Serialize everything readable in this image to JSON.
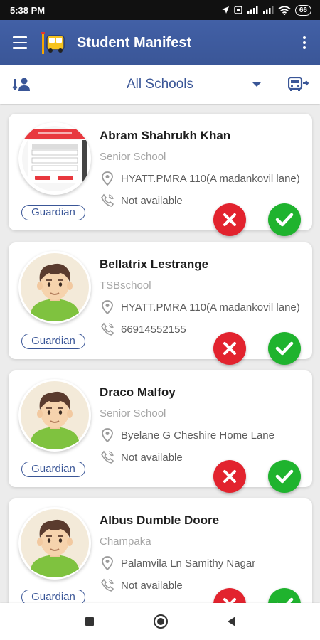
{
  "status_bar": {
    "time": "5:38 PM",
    "battery": "66"
  },
  "app_bar": {
    "title": "Student Manifest",
    "icons": [
      "menu-icon",
      "bus-logo-icon",
      "more-vert-icon"
    ]
  },
  "filter": {
    "selected_school": "All Schools",
    "left_icon": "person-sort-icon",
    "right_icon": "bus-arrow-icon"
  },
  "students": [
    {
      "name": "Abram Shahrukh Khan",
      "school": "Senior School",
      "address": "HYATT.PMRA 110(A madankovil lane)",
      "phone": "Not available",
      "role": "Guardian",
      "avatar": "screenshot-thumbnail"
    },
    {
      "name": "Bellatrix Lestrange",
      "school": "TSBschool",
      "address": "HYATT.PMRA 110(A madankovil lane)",
      "phone": "66914552155",
      "role": "Guardian",
      "avatar": "boy-cartoon"
    },
    {
      "name": "Draco Malfoy",
      "school": "Senior School",
      "address": "Byelane G  Cheshire Home Lane",
      "phone": "Not available",
      "role": "Guardian",
      "avatar": "boy-cartoon"
    },
    {
      "name": "Albus Dumble Doore",
      "school": "Champaka",
      "address": "Palamvila Ln  Samithy Nagar",
      "phone": "Not available",
      "role": "Guardian",
      "avatar": "boy-cartoon"
    }
  ],
  "colors": {
    "primary": "#3a5697",
    "reject": "#e2232e",
    "accept": "#1fb32e",
    "muted_text": "#a6a6a6"
  }
}
